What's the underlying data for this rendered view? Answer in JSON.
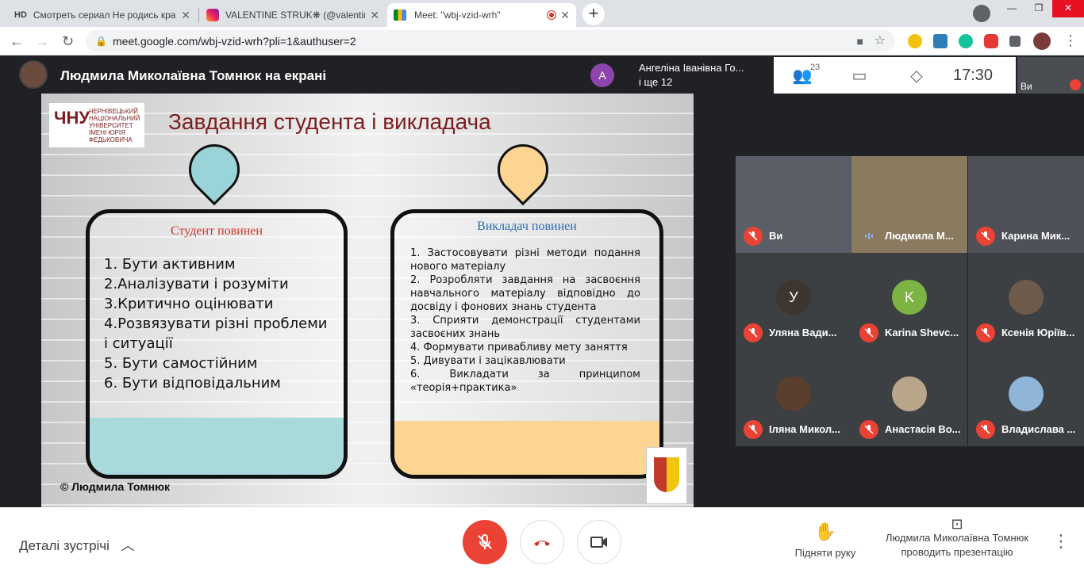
{
  "browser": {
    "tabs": [
      {
        "favicon": "HD",
        "title": "Смотреть сериал Не родись краси",
        "close": "✕"
      },
      {
        "favicon": "instagram-icon",
        "title": "VALENTINE STRUK❋ (@valentinees",
        "close": "✕"
      },
      {
        "favicon": "meet-icon",
        "title": "Meet: \"wbj-vzid-wrh\"",
        "close": "✕"
      }
    ],
    "newtab": "+",
    "url": "meet.google.com/wbj-vzid-wrh?pli=1&authuser=2"
  },
  "meet": {
    "presenter_title": "Людмила Миколаївна Томнюк на екрані",
    "join": {
      "avatar_letter": "А",
      "line1": "Ангеліна Іванівна Го...",
      "line2": "і ще 12"
    },
    "participants_count": "23",
    "time": "17:30",
    "self_label": "Ви",
    "tiles": [
      {
        "name": "Ви",
        "muted": true,
        "kind": "video",
        "bg": "#5a5e66"
      },
      {
        "name": "Людмила М...",
        "muted": false,
        "kind": "video",
        "bg": "#8a7a60"
      },
      {
        "name": "Карина Мик...",
        "muted": true,
        "kind": "video",
        "bg": "#4e5158"
      },
      {
        "name": "Уляна Вади...",
        "muted": true,
        "kind": "letter",
        "letter": "У",
        "color": "#3c3530"
      },
      {
        "name": "Karina Shevc...",
        "muted": true,
        "kind": "letter",
        "letter": "K",
        "color": "#7cb342"
      },
      {
        "name": "Ксенія Юріїв...",
        "muted": true,
        "kind": "photo",
        "color": "#6d5a4a"
      },
      {
        "name": "Іляна Микол...",
        "muted": true,
        "kind": "photo",
        "color": "#5a3e2e"
      },
      {
        "name": "Анастасія Во...",
        "muted": true,
        "kind": "photo",
        "color": "#b9a58a"
      },
      {
        "name": "Владислава ...",
        "muted": true,
        "kind": "photo",
        "color": "#8fb6d8"
      }
    ]
  },
  "slide": {
    "logo_text": "ЧЕРНІВЕЦЬКИЙ НАЦІОНАЛЬНИЙ УНІВЕРСИТЕТ ІМЕНІ ЮРІЯ ФЕДЬКОВИЧА",
    "logo_mark": "ЧНУ",
    "title": "Завдання студента і викладача",
    "student": {
      "heading": "Студент повинен",
      "items": [
        "1. Бути активним",
        "2.Аналізувати і розуміти",
        "3.Критично оцінювати",
        "4.Розвязувати різні проблеми і ситуації",
        "5. Бути самостійним",
        "6. Бути відповідальним"
      ]
    },
    "teacher": {
      "heading": "Викладач повинен",
      "items": [
        "1. Застосовувати різні методи подання нового матеріалу",
        "2. Розробляти завдання на засвоєння навчального матеріалу відповідно до досвіду і фонових знань студента",
        "3. Сприяти демонстрації студентами засвоєних знань",
        "4. Формувати привабливу мету заняття",
        "5. Дивувати і зацікавлювати",
        "6. Викладати за принципом «теорія+практика»"
      ]
    },
    "copyright": "© Людмила Томнюк",
    "colors": {
      "title": "#7b1e1e",
      "student_heading": "#d0332a",
      "teacher_heading": "#2b6cb0",
      "student_fill": "#a8dadc",
      "teacher_fill": "#fcd592"
    }
  },
  "bottom": {
    "details": "Деталі зустрічі",
    "raise_hand": "Підняти руку",
    "presenting_line1": "Людмила Миколаївна Томнюк",
    "presenting_line2": "проводить презентацію"
  }
}
